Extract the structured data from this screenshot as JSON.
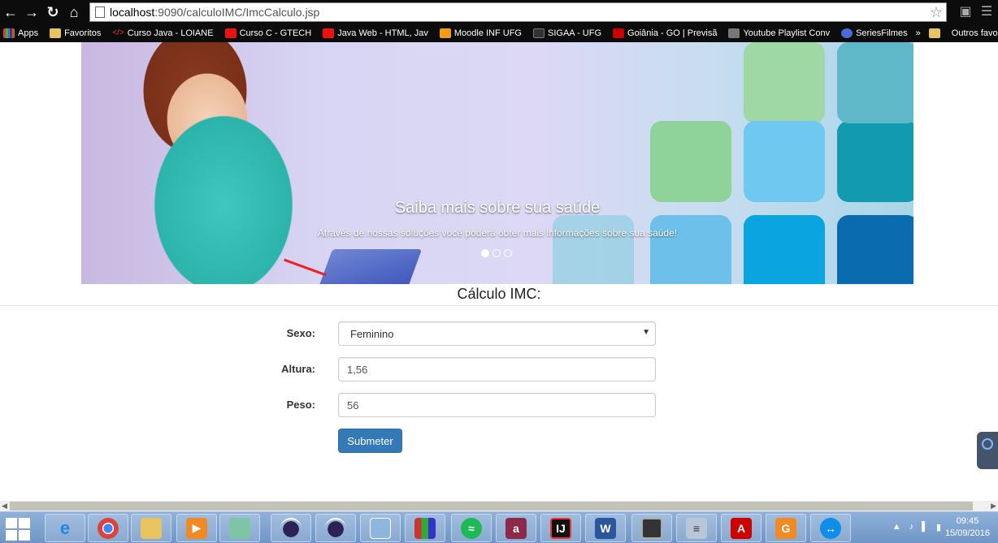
{
  "browser": {
    "url_host": "localhost",
    "url_path": ":9090/calculoIMC/ImcCalculo.jsp"
  },
  "bookmarks": [
    {
      "label": "Apps",
      "icon": "apps-icon"
    },
    {
      "label": "Favoritos",
      "icon": "folder-icon"
    },
    {
      "label": "Curso Java - LOIANE",
      "icon": "code-icon"
    },
    {
      "label": "Curso C - GTECH",
      "icon": "youtube-icon"
    },
    {
      "label": "Java Web - HTML, Jav",
      "icon": "youtube-icon"
    },
    {
      "label": "Moodle INF UFG",
      "icon": "moodle-icon"
    },
    {
      "label": "SIGAA - UFG",
      "icon": "sigaa-icon"
    },
    {
      "label": "Goiânia - GO | Previsã",
      "icon": "weather-icon"
    },
    {
      "label": "Youtube Playlist Conv",
      "icon": "music-icon"
    },
    {
      "label": "SeriesFilmes",
      "icon": "series-icon"
    }
  ],
  "bookmarks_more": "»",
  "bookmarks_other": "Outros favoritos",
  "carousel": {
    "title": "Saiba mais sobre sua saúde",
    "text": "Através de nossas soluções você poderá obter mais informações sobre sua saúde!",
    "slides": 3,
    "active_slide": 1
  },
  "form": {
    "heading": "Cálculo IMC:",
    "sexo_label": "Sexo:",
    "sexo_value": "Feminino",
    "altura_label": "Altura:",
    "altura_value": "1,56",
    "peso_label": "Peso:",
    "peso_value": "56",
    "submit_label": "Submeter"
  },
  "taskbar": {
    "apps": [
      "internet-explorer-icon",
      "chrome-icon",
      "file-explorer-icon",
      "media-player-icon",
      "notepad-icon",
      "eclipse-icon",
      "eclipse-icon",
      "virtualbox-icon",
      "winrar-icon",
      "spotify-icon",
      "aegisub-icon",
      "intellij-icon",
      "word-icon",
      "terminal-icon",
      "calculator-icon",
      "acrobat-icon",
      "pdf-converter-icon",
      "teamviewer-icon"
    ],
    "time": "09:45",
    "date": "15/09/2016"
  }
}
